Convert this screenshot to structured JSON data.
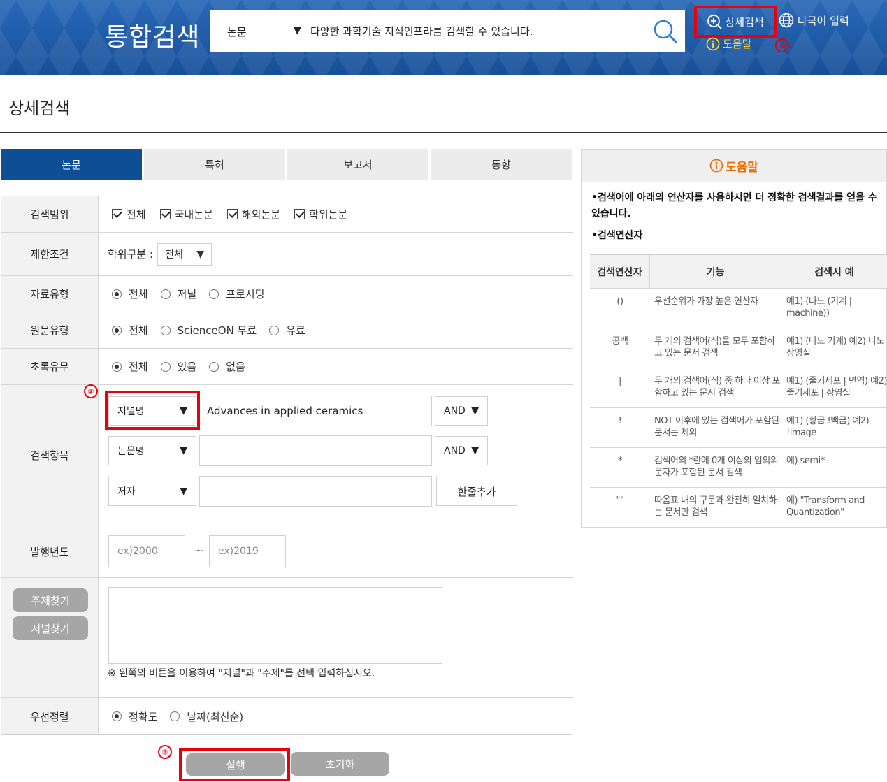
{
  "header": {
    "brand": "통합검색",
    "search_category": "논문",
    "search_placeholder": "다양한 과학기술 지식인프라를 검색할 수 있습니다.",
    "detail_search": "상세검색",
    "multilang_input": "다국어 입력",
    "help": "도움말"
  },
  "markers": {
    "m1": "①",
    "m2": "②",
    "m3": "③"
  },
  "page_title": "상세검색",
  "tabs": [
    {
      "label": "논문",
      "active": true
    },
    {
      "label": "특허",
      "active": false
    },
    {
      "label": "보고서",
      "active": false
    },
    {
      "label": "동향",
      "active": false
    }
  ],
  "form": {
    "scope": {
      "label": "검색범위",
      "options": [
        "전체",
        "국내논문",
        "해외논문",
        "학위논문"
      ]
    },
    "restrict": {
      "label": "제한조건",
      "degree_label": "학위구분 :",
      "degree_value": "전체"
    },
    "data_type": {
      "label": "자료유형",
      "options": [
        "전체",
        "저널",
        "프로시딩"
      ],
      "selected": "전체"
    },
    "fulltext_type": {
      "label": "원문유형",
      "options": [
        "전체",
        "ScienceON 무료",
        "유료"
      ],
      "selected": "전체"
    },
    "abstract": {
      "label": "초록유무",
      "options": [
        "전체",
        "있음",
        "없음"
      ],
      "selected": "전체"
    },
    "fields": {
      "label": "검색항목",
      "rows": [
        {
          "field": "저널명",
          "value": "Advances in applied ceramics",
          "operator": "AND"
        },
        {
          "field": "논문명",
          "value": "",
          "operator": "AND"
        },
        {
          "field": "저자",
          "value": ""
        }
      ],
      "add_line": "한줄추가"
    },
    "year": {
      "label": "발행년도",
      "from_placeholder": "ex)2000",
      "to_placeholder": "ex)2019",
      "separator": "~"
    },
    "finder": {
      "topic_button": "주제찾기",
      "journal_button": "저널찾기",
      "note": "※ 왼쪽의 버튼을 이용하여 \"저널\"과 \"주제\"를 선택 입력하십시오."
    },
    "sort": {
      "label": "우선정렬",
      "options": [
        "정확도",
        "날짜(최신순)"
      ],
      "selected": "정확도"
    }
  },
  "actions": {
    "execute": "실행",
    "reset": "초기화"
  },
  "help_panel": {
    "title": "도움말",
    "desc": "•검색어에 아래의 연산자를 사용하시면 더 정확한 검색결과를 얻을 수 있습니다.",
    "ops_title": "•검색연산자",
    "headers": [
      "검색연산자",
      "기능",
      "검색시 예"
    ],
    "rows": [
      {
        "op": "()",
        "func": "우선순위가 가장 높은 연산자",
        "ex": "예1) (나노 (기계 | machine))"
      },
      {
        "op": "공백",
        "func": "두 개의 검색어(식)을 모두 포함하고 있는 문서 검색",
        "ex": "예1) (나노 기계) 예2) 나노 장영실"
      },
      {
        "op": "|",
        "func": "두 개의 검색어(식) 중 하나 이상 포함하고 있는 문서 검색",
        "ex": "예1) (줄기세포 | 면역) 예2) 줄기세포 | 장영실"
      },
      {
        "op": "!",
        "func": "NOT 이후에 있는 검색어가 포함된 문서는 제외",
        "ex": "예1) (황금 !백금) 예2) !image"
      },
      {
        "op": "*",
        "func": "검색어의 *란에 0개 이상의 임의의 문자가 포함된 문서 검색",
        "ex": "예) semi*"
      },
      {
        "op": "\"\"",
        "func": "따옴표 내의 구문과 완전히 일치하는 문서만 검색",
        "ex": "예) \"Transform and Quantization\""
      }
    ]
  }
}
